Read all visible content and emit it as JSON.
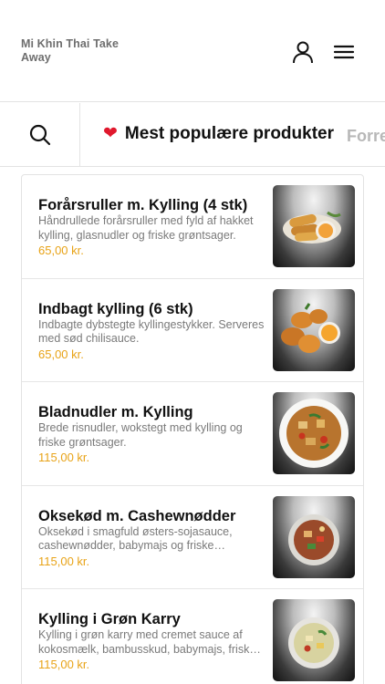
{
  "header": {
    "brand": "Mi Khin Thai Take Away",
    "user_icon": "user-icon",
    "menu_icon": "hamburger-menu-icon"
  },
  "categories": {
    "search_icon": "search-icon",
    "active": {
      "icon": "heart-icon",
      "label": "Mest populære produkter"
    },
    "next": {
      "label": "Forre"
    }
  },
  "colors": {
    "price": "#e8a317",
    "heart": "#e0182d",
    "category_inactive": "#b8b8b8"
  },
  "products": [
    {
      "title": "Forårsruller m. Kylling (4 stk)",
      "description": "Håndrullede forårsruller med fyld af hakket kylling, glasnudler og friske grøntsager.",
      "price": "65,00 kr."
    },
    {
      "title": "Indbagt kylling (6 stk)",
      "description": "Indbagte dybstegte kyllingestykker. Serveres med sød chilisauce.",
      "price": "65,00 kr."
    },
    {
      "title": "Bladnudler m. Kylling",
      "description": "Brede risnudler, wokstegt med kylling og friske grøntsager.",
      "price": "115,00 kr."
    },
    {
      "title": "Oksekød m. Cashewnødder",
      "description": "Oksekød i smagfuld østers-sojasauce, cashewnødder, babymajs og friske peberfrugter.",
      "price": "115,00 kr."
    },
    {
      "title": "Kylling i Grøn Karry",
      "description": "Kylling i grøn karry med cremet sauce af kokosmælk, bambusskud, babymajs, friske grøntsager.",
      "price": "115,00 kr."
    }
  ]
}
